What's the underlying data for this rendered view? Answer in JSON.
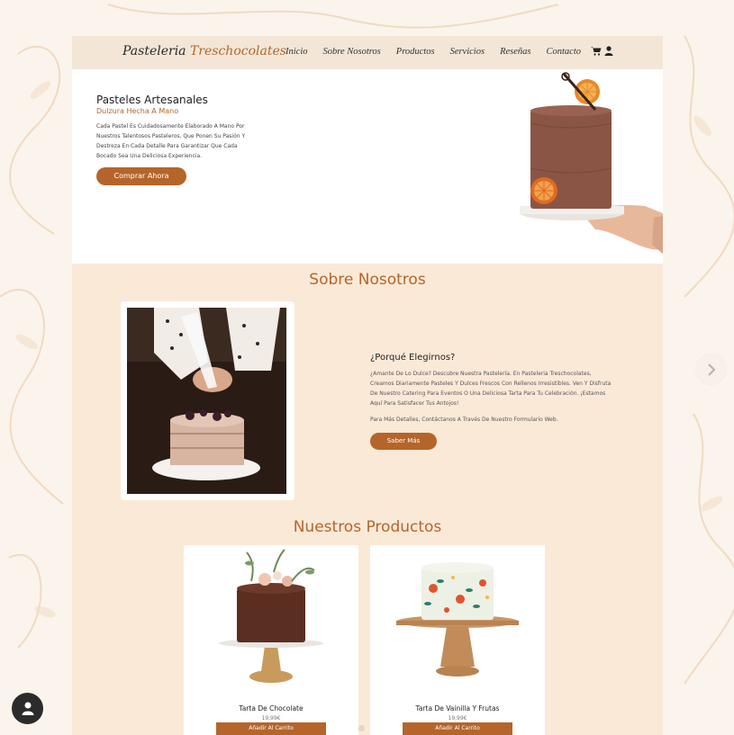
{
  "nav": {
    "brand_main": "Pasteleria",
    "brand_accent": "Treschocolates",
    "menu": [
      "Inicio",
      "Sobre Nosotros",
      "Productos",
      "Servicios",
      "Reseñas",
      "Contacto"
    ],
    "icons": [
      "cart-icon",
      "user-icon"
    ]
  },
  "hero": {
    "title": "Pasteles Artesanales",
    "subtitle": "Dulzura Hecha A Mano",
    "text": "Cada Pastel Es Cuidadosamente Elaborado A Mano Por Nuestros Talentosos Pasteleros, Que Ponen Su Pasión Y Destreza En Cada Detalle Para Garantizar Que Cada Bocado Sea Una Deliciosa Experiencia.",
    "button": "Comprar Ahora"
  },
  "about": {
    "title": "Sobre Nosotros",
    "heading": "¿Porqué Elegirnos?",
    "text": "¿Amante De Lo Dulce? Descubre Nuestra Pastelería. En Pasteleria Treschocolates, Creamos Diariamente Pasteles Y Dulces Frescos Con Rellenos Irresistibles. Ven Y Disfruta De Nuestro Catering Para Eventos O Una Deliciosa Tarta Para Tu Celebración. ¡Estamos Aquí Para Satisfacer Tus Antojos!",
    "text2": "Para Más Detalles, Contáctanos A Través De Nuestro Formulario Web.",
    "button": "Saber Más"
  },
  "products": {
    "title": "Nuestros Productos",
    "items": [
      {
        "name": "Tarta De Chocolate",
        "price": "19,99€",
        "button": "Añadir Al Carrito"
      },
      {
        "name": "Tarta De Vainilla Y Frutas",
        "price": "19,99€",
        "button": "Añadir Al Carrito"
      }
    ]
  },
  "colors": {
    "accent": "#b5652a",
    "nav_bg": "#f3e6d6",
    "section_bg": "#fbe9d7"
  }
}
